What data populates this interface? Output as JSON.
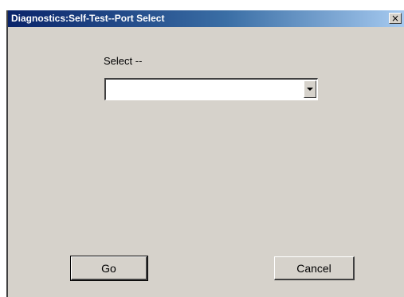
{
  "window": {
    "title": "Diagnostics:Self-Test--Port Select",
    "close_glyph": "×",
    "close_icon": "close-icon"
  },
  "form": {
    "select_label": "Select --",
    "selected_value": "",
    "dropdown_icon": "chevron-down-icon"
  },
  "buttons": {
    "go_label": "Go",
    "cancel_label": "Cancel"
  },
  "colors": {
    "titlebar_start": "#0a246a",
    "titlebar_end": "#a6caf0",
    "dialog_face": "#d6d2cb"
  }
}
